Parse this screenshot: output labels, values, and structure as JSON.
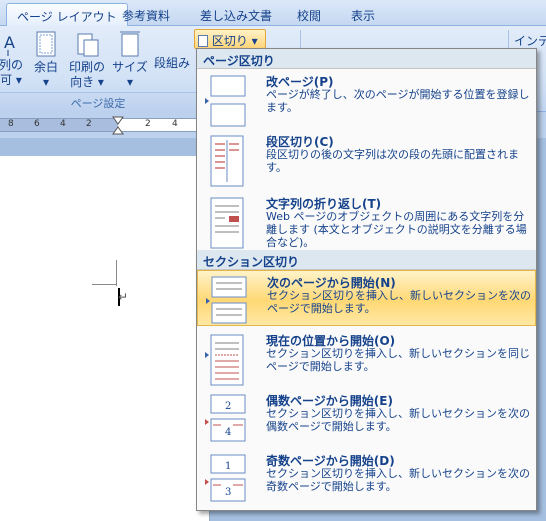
{
  "tabs": [
    "ページ レイアウト",
    "参考資料",
    "差し込み文書",
    "校閲",
    "表示"
  ],
  "ribbon": {
    "buttons": [
      {
        "line1": "列の",
        "line2": "可 ▾"
      },
      {
        "line1": "余白",
        "line2": "▾"
      },
      {
        "line1": "印刷の",
        "line2": "向き ▾"
      },
      {
        "line1": "サイズ",
        "line2": "▾"
      },
      {
        "line1": "段組み",
        "line2": ""
      }
    ],
    "kugiri_label": "区切り ▾",
    "right_text": "インデ",
    "group_label": "ページ設定"
  },
  "ruler": {
    "numbers": [
      "8",
      "6",
      "4",
      "2",
      "2",
      "4"
    ]
  },
  "document": {
    "paragraph_mark": "↵"
  },
  "menu": {
    "section1_title": "ページ区切り",
    "section2_title": "セクション区切り",
    "items": [
      {
        "title": "改ページ(P)",
        "desc": "ページが終了し、次のページが開始する位置を登録します。"
      },
      {
        "title": "段区切り(C)",
        "desc": "段区切りの後の文字列は次の段の先頭に配置されます。"
      },
      {
        "title": "文字列の折り返し(T)",
        "desc": "Web ページのオブジェクトの周囲にある文字列を分離します (本文とオブジェクトの説明文を分離する場合など)。"
      },
      {
        "title": "次のページから開始(N)",
        "desc": "セクション区切りを挿入し、新しいセクションを次のページで開始します。"
      },
      {
        "title": "現在の位置から開始(O)",
        "desc": "セクション区切りを挿入し、新しいセクションを同じページで開始します。"
      },
      {
        "title": "偶数ページから開始(E)",
        "desc": "セクション区切りを挿入し、新しいセクションを次の偶数ページで開始します。",
        "icon_digits": [
          "2",
          "4"
        ]
      },
      {
        "title": "奇数ページから開始(D)",
        "desc": "セクション区切りを挿入し、新しいセクションを次の奇数ページで開始します。",
        "icon_digits": [
          "1",
          "3"
        ]
      }
    ]
  },
  "colors": {
    "accent": "#15428b",
    "highlight": "#ffd875",
    "ribbon": "#d3e2f6"
  }
}
